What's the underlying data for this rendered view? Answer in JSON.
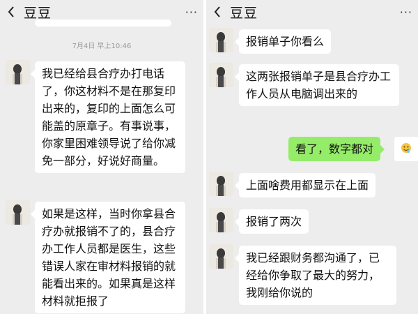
{
  "left_chat": {
    "title": "豆豆",
    "more": "···",
    "timestamp": "7月4日 早上10:46",
    "messages": [
      {
        "sender": "contact",
        "text": "我已经给县合疗办打电话了，你这材料不是在那复印出来的，复印的上面怎么可能盖的原章子。有事说事，你家里困难领导说了给你减免一部分，好说好商量。"
      },
      {
        "sender": "contact",
        "text": "如果是这样，当时你拿县合疗办就报销不了的，县合疗办工作人员都是医生，这些错误人家在审材料报销的就能看出来的。如果真是这样材料就拒报了"
      }
    ]
  },
  "right_chat": {
    "title": "豆豆",
    "more": "···",
    "messages": [
      {
        "sender": "contact",
        "text": "报销单子你看么"
      },
      {
        "sender": "contact",
        "text": "这两张报销单子是县合疗办工作人员从电脑调出来的"
      },
      {
        "sender": "self",
        "text": "看了，数字都对"
      },
      {
        "sender": "contact",
        "text": "上面啥费用都显示在上面"
      },
      {
        "sender": "contact",
        "text": "报销了两次"
      },
      {
        "sender": "contact",
        "text": "我已经跟财务都沟通了，已经给你争取了最大的努力，我刚给你说的"
      }
    ]
  },
  "icons": {
    "back": "chevron-left-icon",
    "more": "more-dots-icon",
    "self_avatar": "smiley-emoji-avatar-icon",
    "contact_avatar": "contact-photo-avatar"
  },
  "colors": {
    "background": "#ededed",
    "incoming_bubble": "#ffffff",
    "outgoing_bubble": "#95ec69",
    "text": "#111111",
    "timestamp": "#9a9a9a"
  }
}
